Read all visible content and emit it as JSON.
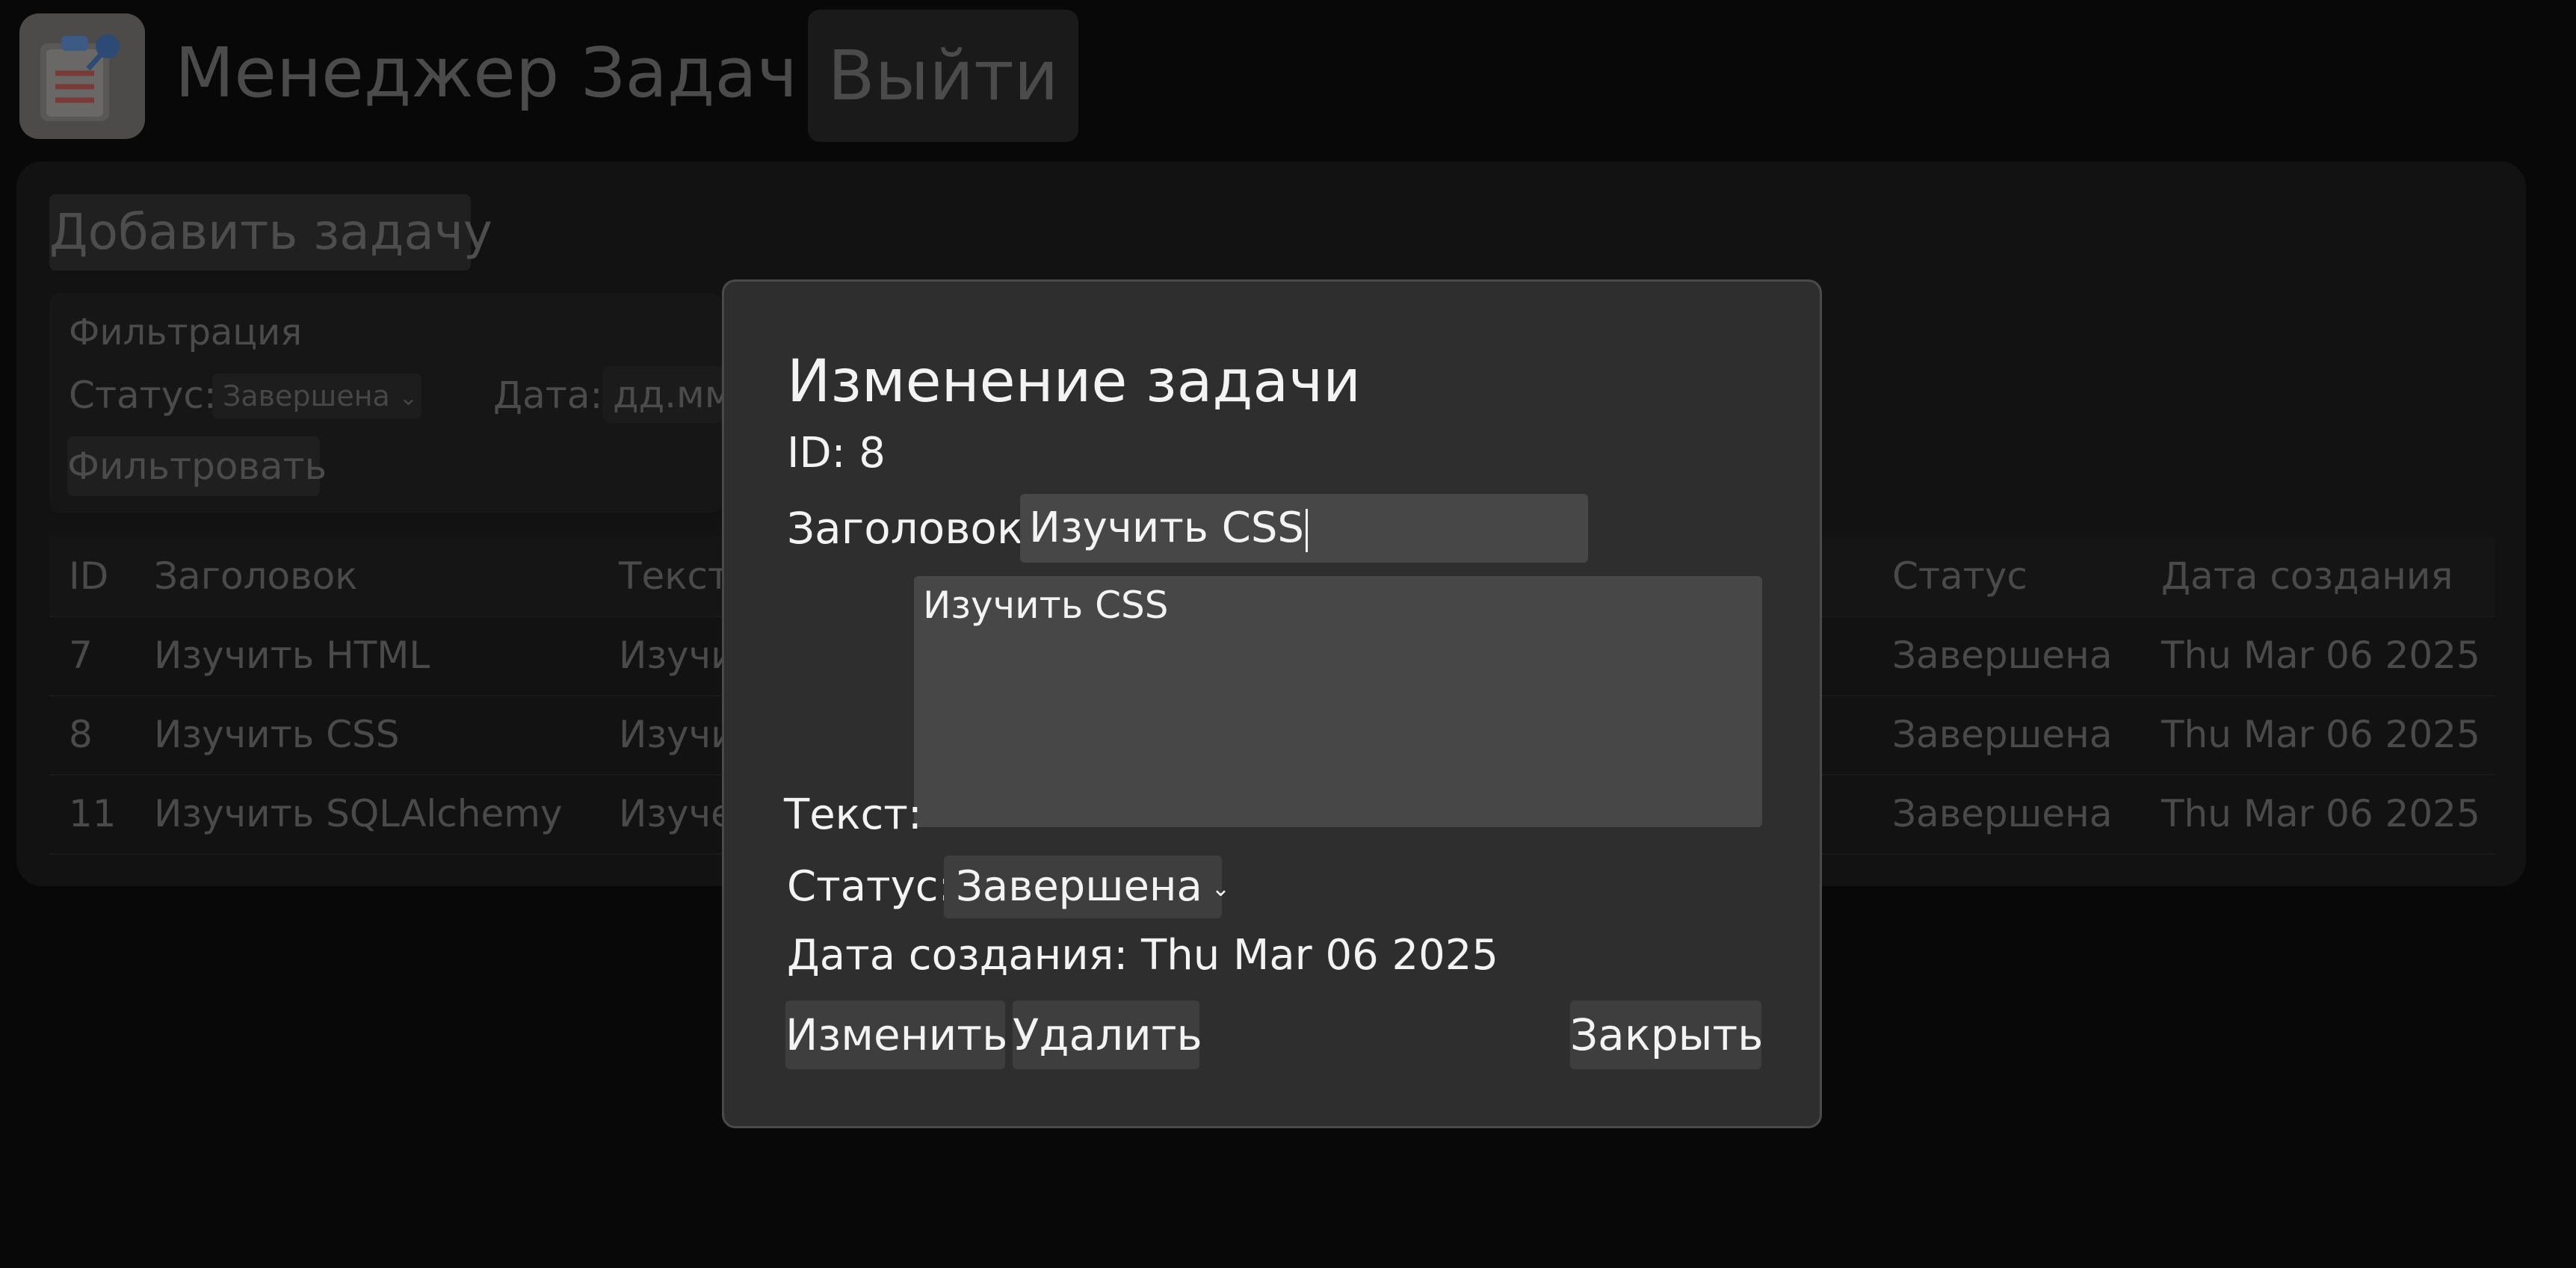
{
  "header": {
    "app_title": "Менеджер Задач",
    "logout_label": "Выйти",
    "logo_icon": "clipboard-pin-icon"
  },
  "toolbar": {
    "add_task_label": "Добавить задачу"
  },
  "filter": {
    "title": "Фильтрация",
    "status_label": "Статус:",
    "status_value": "Завершена",
    "date_label": "Дата:",
    "date_placeholder": "дд.мм",
    "filter_button": "Фильтровать"
  },
  "table": {
    "columns": [
      "ID",
      "Заголовок",
      "Текст",
      "Статус",
      "Дата создания"
    ],
    "rows": [
      {
        "id": "7",
        "title": "Изучить HTML",
        "text": "Изучи",
        "status": "Завершена",
        "date": "Thu Mar 06 2025"
      },
      {
        "id": "8",
        "title": "Изучить CSS",
        "text": "Изучи",
        "status": "Завершена",
        "date": "Thu Mar 06 2025"
      },
      {
        "id": "11",
        "title": "Изучить SQLAlchemy",
        "text": "Изуче",
        "status": "Завершена",
        "date": "Thu Mar 06 2025"
      }
    ]
  },
  "modal": {
    "title": "Изменение задачи",
    "id_text": "ID: 8",
    "title_label": "Заголовок:",
    "title_value": "Изучить CSS",
    "text_label": "Текст:",
    "text_value": "Изучить CSS",
    "status_label": "Статус:",
    "status_value": "Завершена",
    "date_text": "Дата создания: Thu Mar 06 2025",
    "edit_button": "Изменить",
    "delete_button": "Удалить",
    "close_button": "Закрыть"
  },
  "colors": {
    "page_background": "#080808",
    "modal_background": "#2e2e2e",
    "input_background": "#474747",
    "logo_red": "#e0433a",
    "logo_blue": "#2f5f9a"
  }
}
